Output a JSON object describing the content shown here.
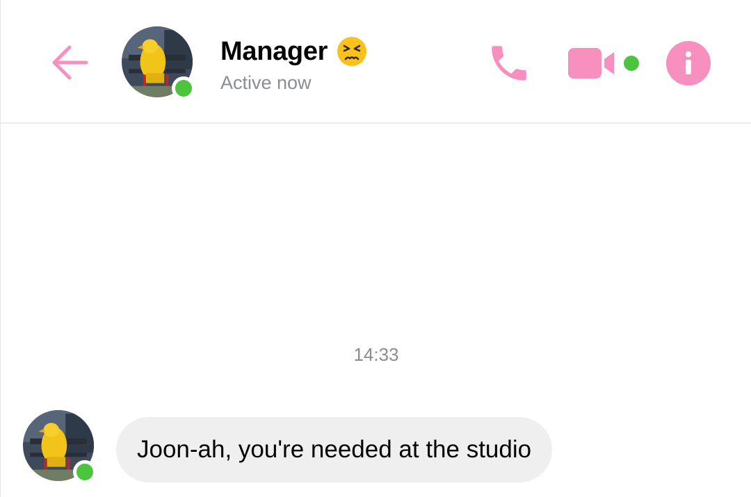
{
  "header": {
    "contact_name": "Manager",
    "status_emoji": "persevering-face-emoji",
    "status_text": "Active now",
    "back_icon": "arrow-left-icon",
    "call_icon": "phone-icon",
    "video_icon": "video-camera-icon",
    "info_icon": "info-icon",
    "avatar_online": true
  },
  "thread": {
    "timestamp": "14:33",
    "messages": [
      {
        "from": "Manager",
        "text": "Joon-ah, you're needed at the studio",
        "avatar_online": true
      }
    ]
  },
  "colors": {
    "accent": "#f78fbf",
    "online": "#4cc43e",
    "bubble_bg": "#efefef",
    "secondary_text": "#8a8d91"
  }
}
